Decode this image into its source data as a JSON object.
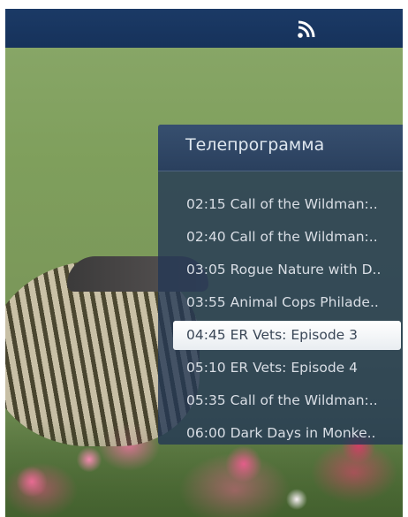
{
  "colors": {
    "topbar": "#16325b",
    "panel_bg": "#23375580",
    "selected_bg": "#ffffff"
  },
  "topbar": {
    "icon": "rss-feed-icon"
  },
  "panel": {
    "title": "Телепрограмма",
    "items": [
      {
        "label": "02:15 Call of the Wildman:..",
        "selected": false
      },
      {
        "label": "02:40 Call of the Wildman:..",
        "selected": false
      },
      {
        "label": "03:05 Rogue Nature with D..",
        "selected": false
      },
      {
        "label": "03:55 Animal Cops Philade..",
        "selected": false
      },
      {
        "label": "04:45 ER Vets: Episode 3",
        "selected": true
      },
      {
        "label": "05:10 ER Vets: Episode 4",
        "selected": false
      },
      {
        "label": "05:35 Call of the Wildman:..",
        "selected": false
      },
      {
        "label": "06:00 Dark Days in Monke..",
        "selected": false
      }
    ]
  }
}
